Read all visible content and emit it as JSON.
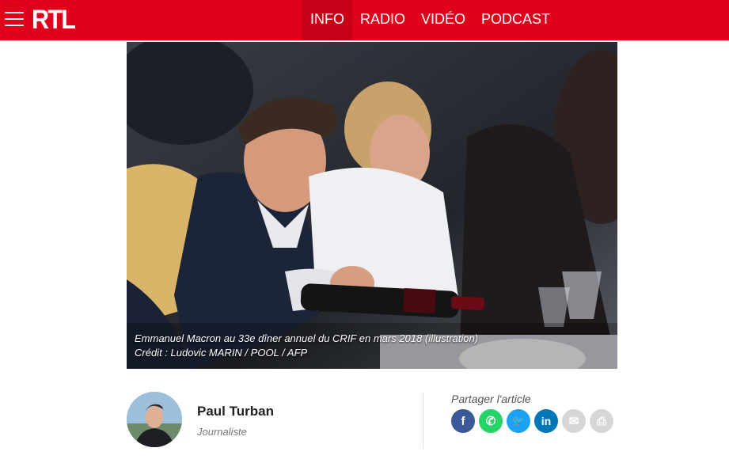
{
  "header": {
    "logo": "RTL",
    "nav": [
      {
        "label": "INFO",
        "active": true
      },
      {
        "label": "RADIO",
        "active": false
      },
      {
        "label": "VIDÉO",
        "active": false
      },
      {
        "label": "PODCAST",
        "active": false
      }
    ],
    "menu_icon": "hamburger-icon"
  },
  "hero": {
    "caption_line1": "Emmanuel Macron au 33e dîner annuel du CRIF en mars 2018 (illustration)",
    "caption_line2": "Crédit : Ludovic MARIN / POOL / AFP"
  },
  "author": {
    "name": "Paul Turban",
    "role": "Journaliste"
  },
  "share": {
    "title": "Partager l'article",
    "buttons": [
      {
        "icon": "facebook-icon",
        "glyph": "f",
        "color": "#3b5998"
      },
      {
        "icon": "whatsapp-icon",
        "glyph": "✆",
        "color": "#25d366"
      },
      {
        "icon": "twitter-icon",
        "glyph": "🐦",
        "color": "#1da1f2"
      },
      {
        "icon": "linkedin-icon",
        "glyph": "in",
        "color": "#0077b5"
      },
      {
        "icon": "email-icon",
        "glyph": "✉",
        "color": "#d6d6d6"
      },
      {
        "icon": "print-icon",
        "glyph": "⎙",
        "color": "#d6d6d6"
      }
    ]
  },
  "colors": {
    "brand_red": "#e1001b",
    "nav_active": "#c70018"
  }
}
